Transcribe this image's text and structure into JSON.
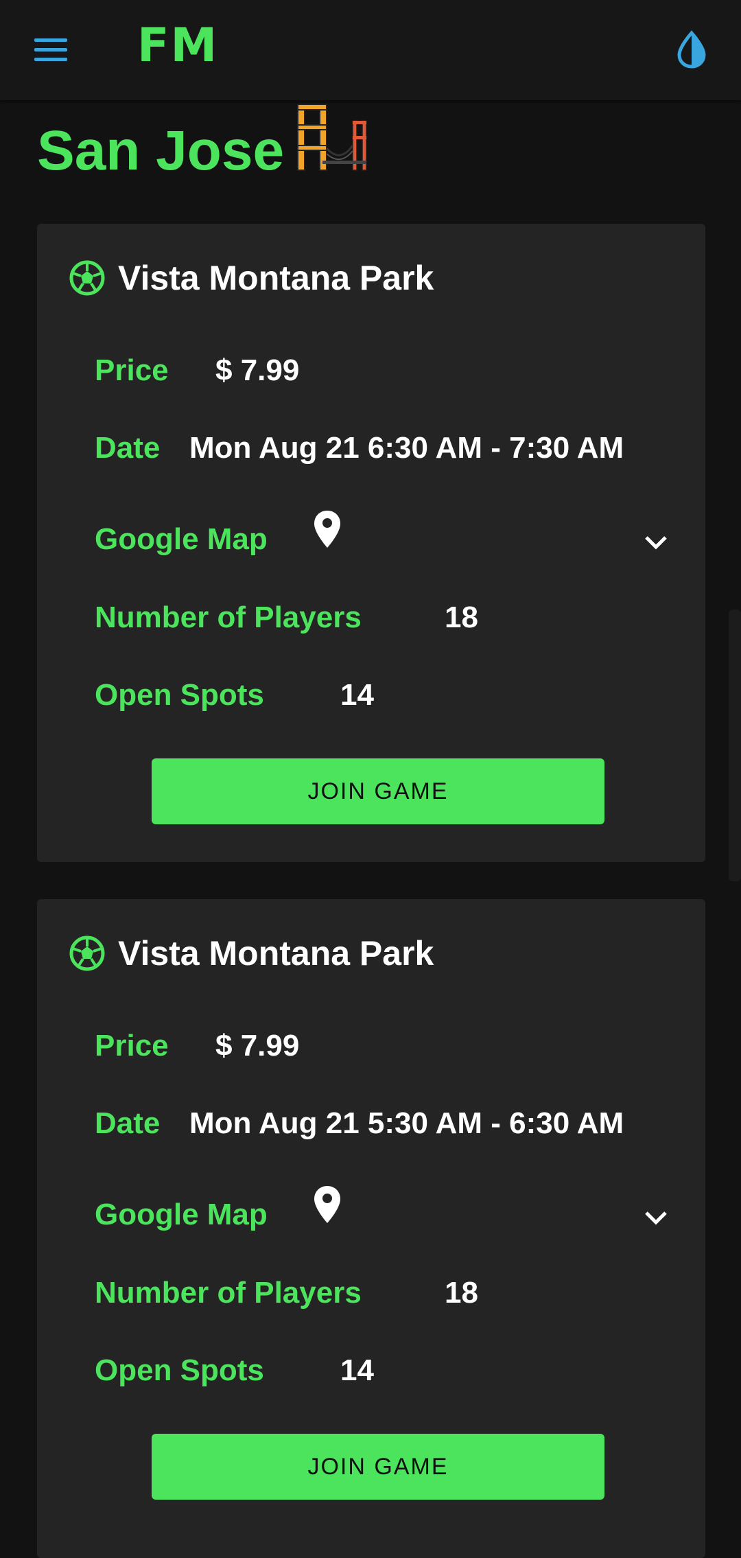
{
  "header": {
    "logo": "FM",
    "menu_icon": "hamburger-menu-icon",
    "theme_icon": "water-drop-icon",
    "accent_color": "#3aa6e0"
  },
  "city": {
    "name": "San Jose",
    "emoji_icon": "golden-gate-bridge-icon"
  },
  "colors": {
    "green": "#4be45c",
    "card_bg": "#242424",
    "page_bg": "#121212"
  },
  "labels": {
    "price": "Price",
    "date": "Date",
    "map": "Google Map",
    "players": "Number of Players",
    "spots": "Open Spots",
    "join": "JOIN GAME"
  },
  "games": [
    {
      "park": "Vista Montana Park",
      "price": "$ 7.99",
      "date": "Mon Aug 21 6:30 AM - 7:30 AM",
      "players": "18",
      "open_spots": "14"
    },
    {
      "park": "Vista Montana Park",
      "price": "$ 7.99",
      "date": "Mon Aug 21 5:30 AM - 6:30 AM",
      "players": "18",
      "open_spots": "14"
    }
  ]
}
